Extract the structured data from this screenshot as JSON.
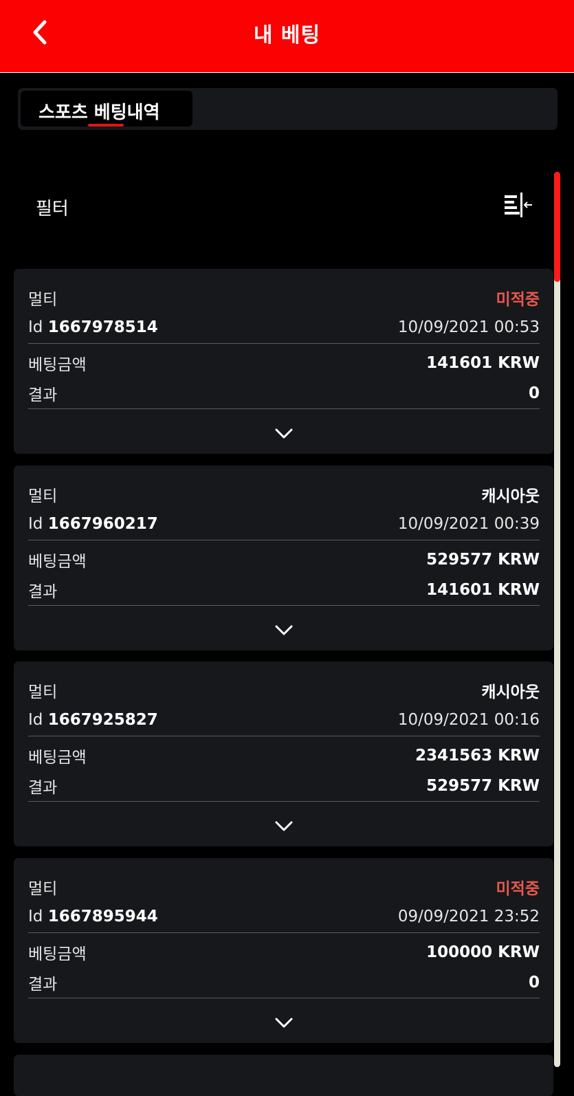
{
  "header": {
    "title": "내 베팅"
  },
  "tabs": [
    {
      "label": "스포츠 베팅내역",
      "active": true
    }
  ],
  "filter": {
    "label": "필터",
    "icon": "filter-sort-icon"
  },
  "colors": {
    "header_bg": "#fb0102",
    "lost_status": "#e8594d",
    "card_bg": "#17181c",
    "scroll_thumb": "#ff1a1a"
  },
  "labels": {
    "bet_amount": "베팅금액",
    "result": "결과",
    "id_prefix": "Id"
  },
  "bets": [
    {
      "type": "멀티",
      "status": "미적중",
      "status_kind": "lost",
      "id": "1667978514",
      "datetime": "10/09/2021 00:53",
      "amount": "141601 KRW",
      "result": "0"
    },
    {
      "type": "멀티",
      "status": "캐시아웃",
      "status_kind": "cashout",
      "id": "1667960217",
      "datetime": "10/09/2021 00:39",
      "amount": "529577 KRW",
      "result": "141601 KRW"
    },
    {
      "type": "멀티",
      "status": "캐시아웃",
      "status_kind": "cashout",
      "id": "1667925827",
      "datetime": "10/09/2021 00:16",
      "amount": "2341563 KRW",
      "result": "529577 KRW"
    },
    {
      "type": "멀티",
      "status": "미적중",
      "status_kind": "lost",
      "id": "1667895944",
      "datetime": "09/09/2021 23:52",
      "amount": "100000 KRW",
      "result": "0"
    }
  ]
}
